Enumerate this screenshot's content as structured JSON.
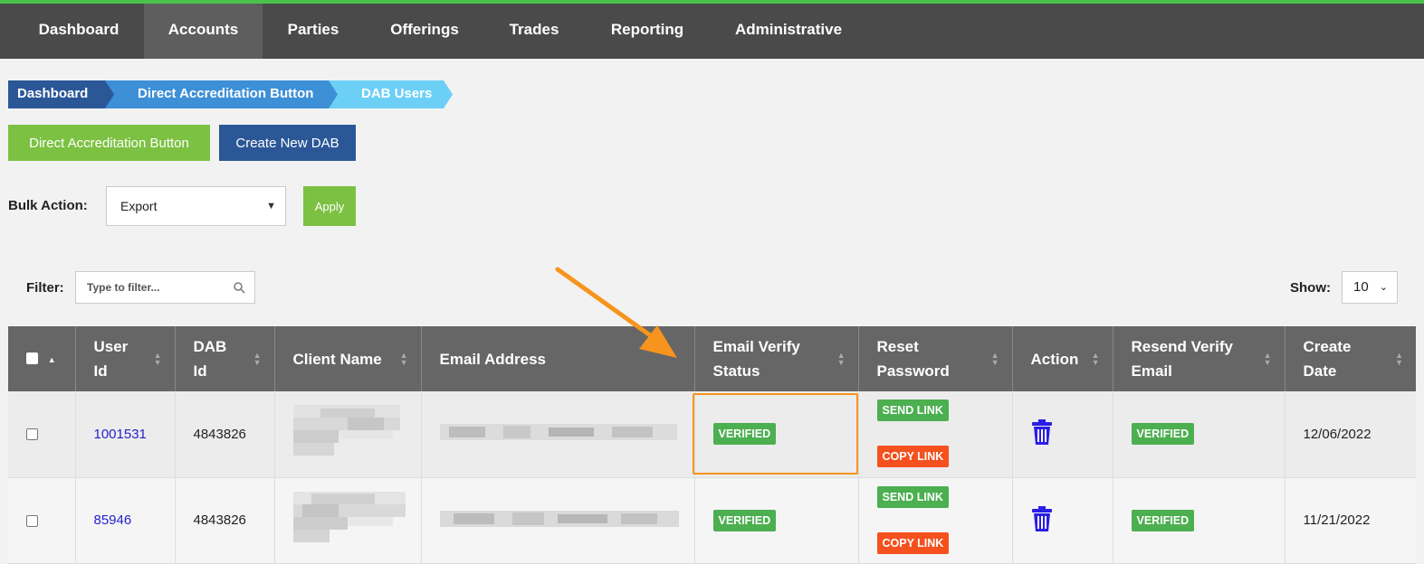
{
  "nav": {
    "items": [
      "Dashboard",
      "Accounts",
      "Parties",
      "Offerings",
      "Trades",
      "Reporting",
      "Administrative"
    ],
    "active": "Accounts"
  },
  "breadcrumb": [
    "Dashboard",
    "Direct Accreditation Button",
    "DAB Users"
  ],
  "actions": {
    "dab_button": "Direct Accreditation Button",
    "create_button": "Create New DAB"
  },
  "bulk": {
    "label": "Bulk Action:",
    "selected": "Export",
    "apply": "Apply"
  },
  "filter": {
    "label": "Filter:",
    "placeholder": "Type to filter..."
  },
  "show": {
    "label": "Show:",
    "value": "10"
  },
  "table": {
    "headers": {
      "user_id": [
        "User",
        "Id"
      ],
      "dab_id": [
        "DAB",
        "Id"
      ],
      "client_name": "Client Name",
      "email": "Email Address",
      "email_verify": [
        "Email Verify",
        "Status"
      ],
      "reset_password": [
        "Reset",
        "Password"
      ],
      "action": "Action",
      "resend": [
        "Resend Verify",
        "Email"
      ],
      "create_date": [
        "Create",
        "Date"
      ]
    },
    "rows": [
      {
        "user_id": "1001531",
        "dab_id": "4843826",
        "status": "VERIFIED",
        "send_link": "SEND LINK",
        "copy_link": "COPY LINK",
        "resend": "VERIFIED",
        "date": "12/06/2022"
      },
      {
        "user_id": "85946",
        "dab_id": "4843826",
        "status": "VERIFIED",
        "send_link": "SEND LINK",
        "copy_link": "COPY LINK",
        "resend": "VERIFIED",
        "date": "11/21/2022"
      }
    ]
  },
  "colors": {
    "accent_green": "#7cc142",
    "nav_bg": "#4a4a4a",
    "badge_green": "#4caf50",
    "badge_orange": "#f4511e",
    "highlight": "#f7941d",
    "trash": "#2a1ee6"
  }
}
